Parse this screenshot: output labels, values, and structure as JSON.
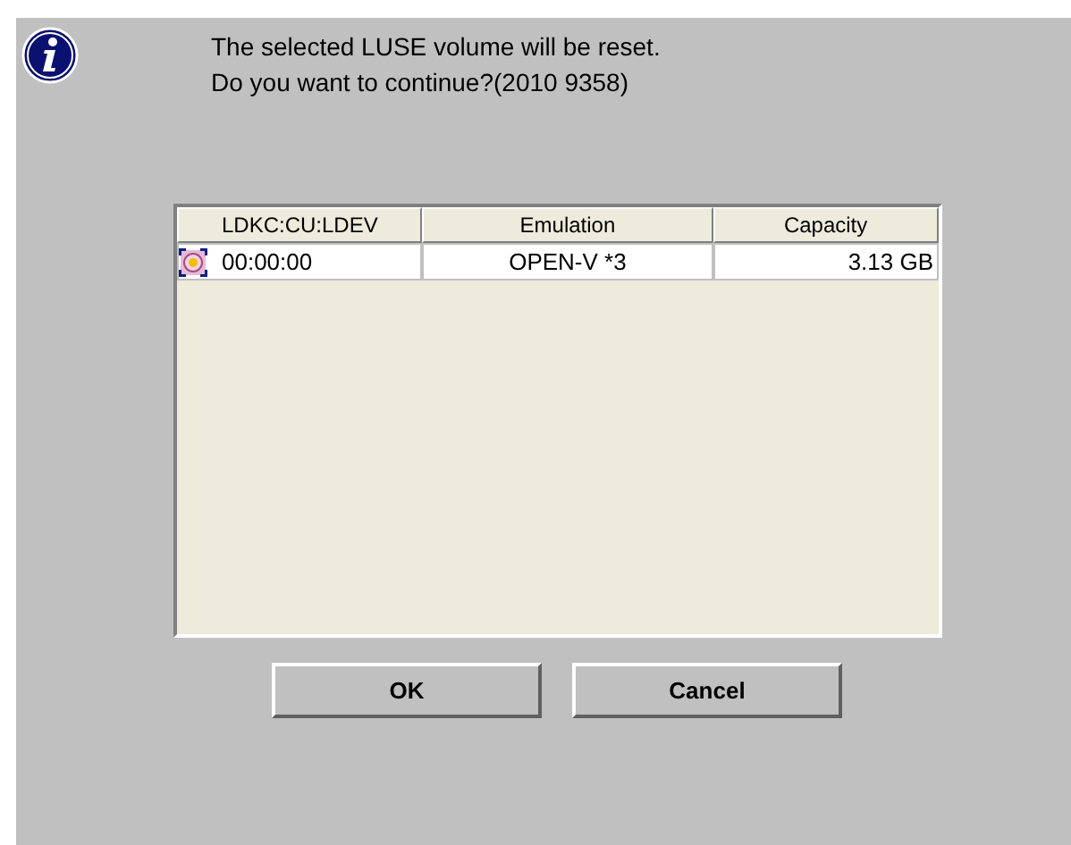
{
  "message": [
    "The selected LUSE volume will be reset.",
    "Do you want to continue?(2010 9358)"
  ],
  "table": {
    "columns": [
      "LDKC:CU:LDEV",
      "Emulation",
      "Capacity"
    ],
    "rows": [
      {
        "ldev": "00:00:00",
        "emulation": "OPEN-V *3",
        "capacity": "3.13 GB"
      }
    ]
  },
  "buttons": [
    "OK",
    "Cancel"
  ]
}
